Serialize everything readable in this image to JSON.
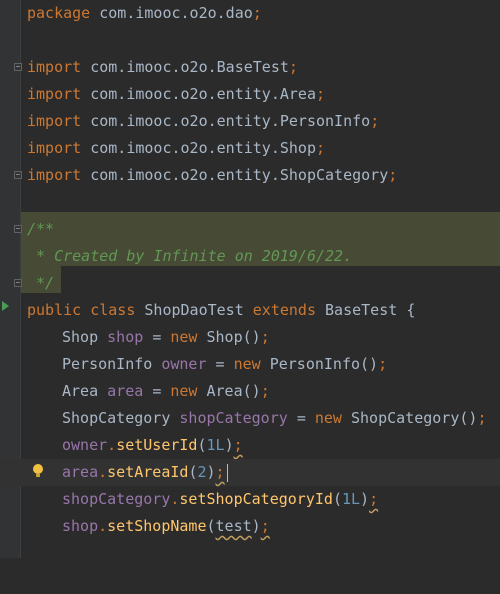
{
  "editor": {
    "lines": {
      "package": {
        "kw": "package",
        "name": "com.imooc.o2o.dao",
        "semi": ";"
      },
      "imports": [
        {
          "kw": "import",
          "name": "com.imooc.o2o.BaseTest",
          "semi": ";"
        },
        {
          "kw": "import",
          "name": "com.imooc.o2o.entity.Area",
          "semi": ";"
        },
        {
          "kw": "import",
          "name": "com.imooc.o2o.entity.PersonInfo",
          "semi": ";"
        },
        {
          "kw": "import",
          "name": "com.imooc.o2o.entity.Shop",
          "semi": ";"
        },
        {
          "kw": "import",
          "name": "com.imooc.o2o.entity.ShopCategory",
          "semi": ";"
        }
      ],
      "doc": {
        "open": "/**",
        "body": " * Created by Infinite on 2019/6/22.",
        "close": " */"
      },
      "class_decl": {
        "kw1": "public",
        "kw2": "class",
        "name": "ShopDaoTest",
        "kw3": "extends",
        "base": "BaseTest",
        "brace": "{"
      },
      "fields": [
        {
          "type": "Shop",
          "field": "shop",
          "eq": "=",
          "kw": "new",
          "ctor": "Shop()",
          "semi": ";"
        },
        {
          "type": "PersonInfo",
          "field": "owner",
          "eq": "=",
          "kw": "new",
          "ctor": "PersonInfo()",
          "semi": ";"
        },
        {
          "type": "Area",
          "field": "area",
          "eq": "=",
          "kw": "new",
          "ctor": "Area()",
          "semi": ";"
        },
        {
          "type": "ShopCategory",
          "field": "shopCategory",
          "eq": "=",
          "kw": "new",
          "ctor": "ShopCategory()",
          "semi": ";"
        }
      ],
      "calls": [
        {
          "obj": "owner",
          "dot": ".",
          "method": "setUserId",
          "open": "(",
          "arg": "1L",
          "close": ")",
          "semi": ";"
        },
        {
          "obj": "area",
          "dot": ".",
          "method": "setAreaId",
          "open": "(",
          "arg": "2",
          "close": ")",
          "semi": ";"
        },
        {
          "obj": "shopCategory",
          "dot": ".",
          "method": "setShopCategoryId",
          "open": "(",
          "arg": "1L",
          "close": ")",
          "semi": ";"
        },
        {
          "obj": "shop",
          "dot": ".",
          "method": "setShopName",
          "open": "(",
          "arg": "test",
          "close": ")",
          "semi": ";"
        }
      ]
    },
    "colors": {
      "background": "#2b2b2b",
      "keyword": "#cc7832",
      "field": "#9876aa",
      "method": "#ffc66d",
      "number": "#6897bb",
      "doc_comment": "#629755",
      "doc_highlight": "#474b35"
    }
  }
}
